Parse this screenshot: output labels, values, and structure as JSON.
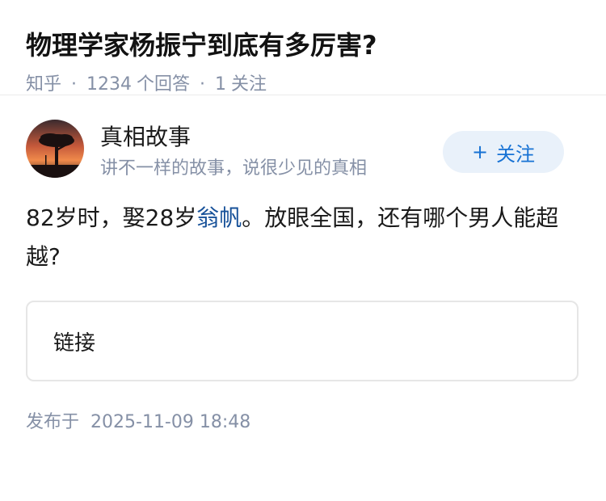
{
  "question": {
    "title": "物理学家杨振宁到底有多厉害?",
    "source": "知乎",
    "answer_count": "1234",
    "answer_label": "个回答",
    "follower_count": "1",
    "follower_label": "关注"
  },
  "answer": {
    "author": {
      "name": "真相故事",
      "bio": "讲不一样的故事，说很少见的真相",
      "avatar_icon": "tree-sunset-avatar",
      "follow_label": "关注"
    },
    "content_before": "82岁时，娶28岁",
    "content_link": "翁帆",
    "content_after": "。放眼全国，还有哪个男人能超越?",
    "link_card_label": "链接",
    "publish_label": "发布于",
    "publish_time": "2025-11-09 18:48"
  },
  "colors": {
    "accent": "#1772d4",
    "link": "#175199",
    "meta": "#8590a6",
    "follow_bg": "#e9f1fa"
  }
}
